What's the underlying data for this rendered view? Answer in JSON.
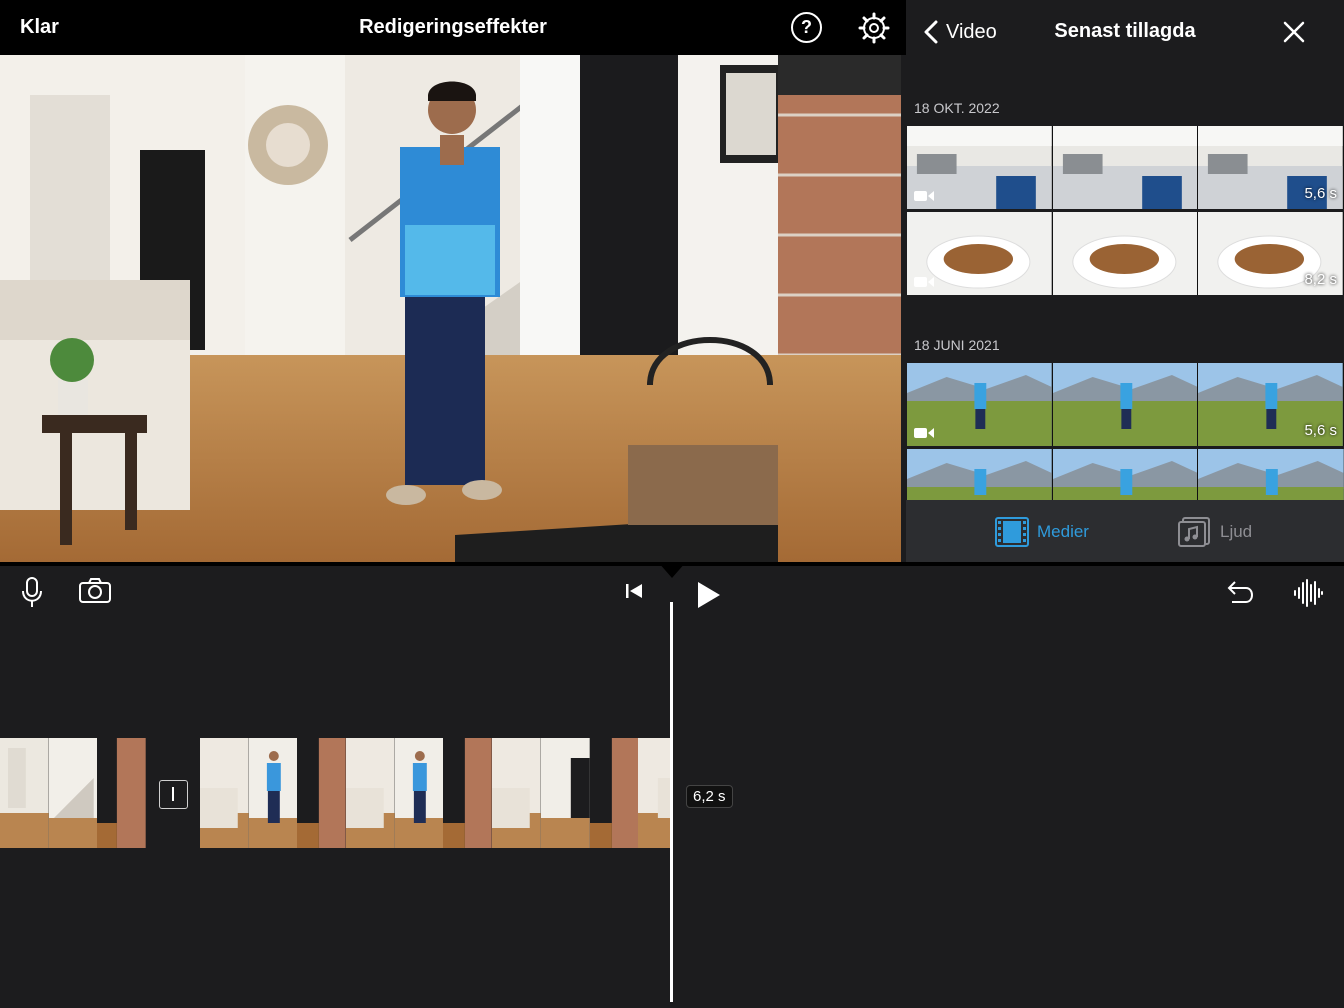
{
  "header": {
    "done_label": "Klar",
    "title": "Redigeringseffekter",
    "help_icon": "help-icon",
    "settings_icon": "gear-icon"
  },
  "viewer": {
    "description_icon": "video-preview"
  },
  "browser": {
    "back_label": "Video",
    "title": "Senast tillagda",
    "close_icon": "close-icon",
    "sections": [
      {
        "date": "18 OKT. 2022",
        "items": [
          {
            "kind": "video",
            "duration": "5,6 s",
            "scene": "kitchen"
          },
          {
            "kind": "video",
            "duration": "8,2 s",
            "scene": "cookies"
          }
        ]
      },
      {
        "date": "18 JUNI 2021",
        "items": [
          {
            "kind": "video",
            "duration": "5,6 s",
            "scene": "meadow"
          },
          {
            "kind": "video",
            "duration": "",
            "scene": "meadow"
          }
        ]
      }
    ],
    "tabs": [
      {
        "label": "Medier",
        "icon": "film-icon",
        "selected": true
      },
      {
        "label": "Ljud",
        "icon": "music-note-icon",
        "selected": false
      }
    ],
    "accent_color": "#2f9bdc"
  },
  "timeline": {
    "tools": [
      "microphone-icon",
      "camera-icon",
      "skip-to-start-icon",
      "play-icon",
      "undo-icon",
      "audio-waveform-icon"
    ],
    "selected_duration": "6,2 s"
  }
}
